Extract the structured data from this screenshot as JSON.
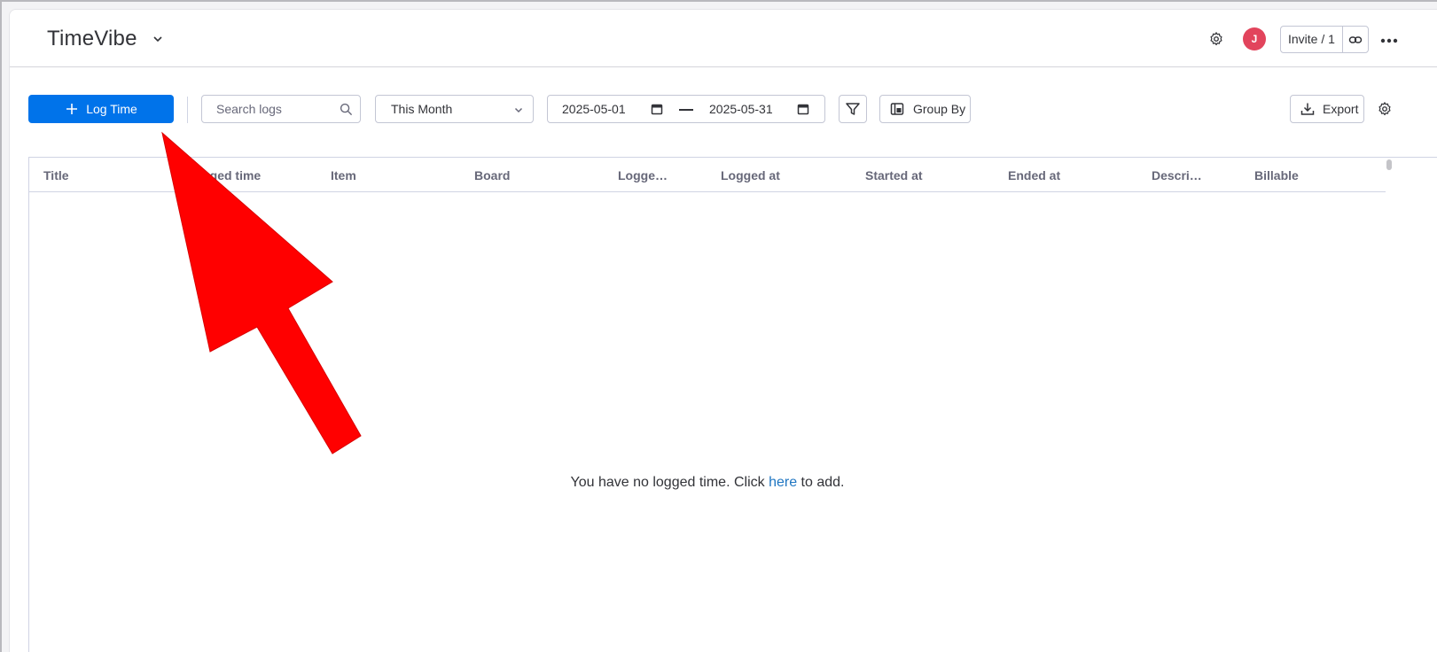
{
  "header": {
    "app_title": "TimeVibe",
    "avatar_initial": "J",
    "invite_label": "Invite / 1"
  },
  "toolbar": {
    "log_time_label": "Log Time",
    "search_placeholder": "Search logs",
    "period_selected": "This Month",
    "date_from": "2025-05-01",
    "date_to": "2025-05-31",
    "group_by_label": "Group By",
    "export_label": "Export"
  },
  "table": {
    "columns": [
      "Title",
      "Logged time",
      "Item",
      "Board",
      "Logge…",
      "Logged at",
      "Started at",
      "Ended at",
      "Descri…",
      "Billable"
    ],
    "empty_prefix": "You have no logged time. Click ",
    "empty_link": "here",
    "empty_suffix": " to add."
  },
  "colors": {
    "primary": "#0073ea",
    "avatar": "#e2445c",
    "annotation_arrow": "#ff0000"
  },
  "icons": [
    "chevron-down-icon",
    "gear-icon",
    "link-icon",
    "more-dots-icon",
    "plus-icon",
    "search-icon",
    "calendar-icon",
    "filter-icon",
    "group-by-icon",
    "export-icon"
  ]
}
